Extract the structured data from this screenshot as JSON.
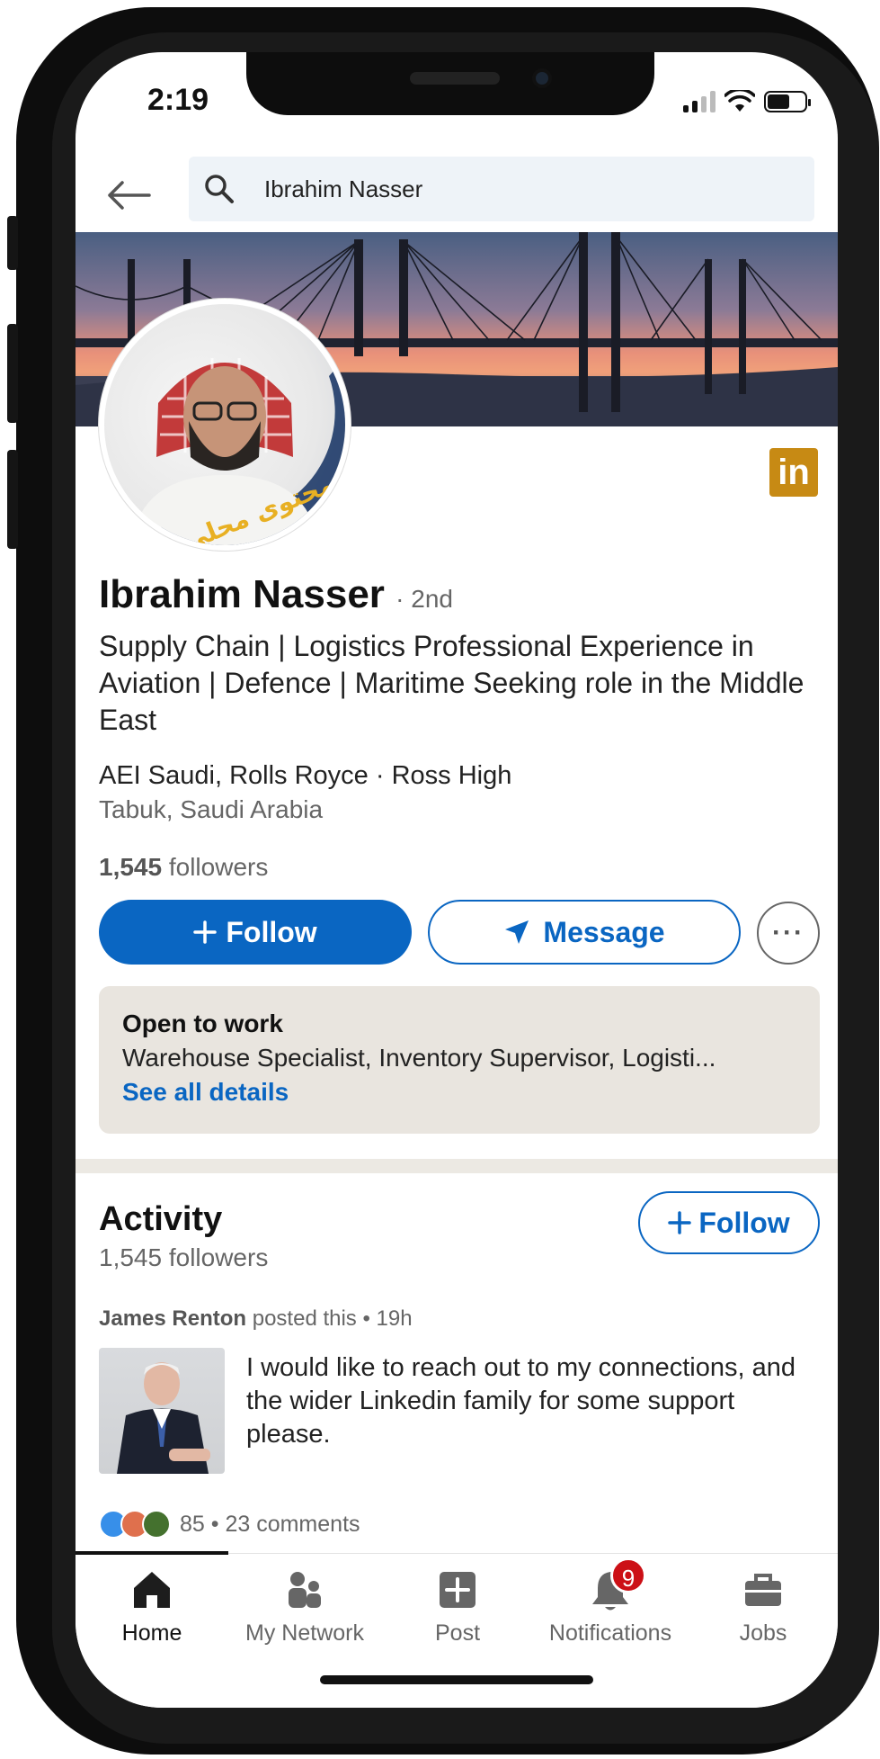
{
  "status_bar": {
    "time": "2:19"
  },
  "search": {
    "query": "Ibrahim Nasser"
  },
  "profile": {
    "name": "Ibrahim Nasser",
    "degree": "· 2nd",
    "headline": "Supply Chain | Logistics Professional Experience in Aviation | Defence | Maritime Seeking role in the Middle East",
    "company": "AEI Saudi, Rolls Royce · Ross High",
    "location": "Tabuk, Saudi Arabia",
    "followers_count": "1,545",
    "followers_label": " followers",
    "avatar_text_line1": "أنا محتوى محلي",
    "linkedin_badge": "in"
  },
  "actions": {
    "follow_label": "Follow",
    "message_label": "Message",
    "more_label": "···"
  },
  "open_to_work": {
    "title": "Open to work",
    "roles": "Warehouse Specialist, Inventory Supervisor, Logisti...",
    "link": "See all details"
  },
  "activity": {
    "title": "Activity",
    "followers": "1,545 followers",
    "follow_label": "Follow",
    "post": {
      "author": "James Renton",
      "meta": " posted this • 19h",
      "text": "I would like to reach out to my connections, and the wider Linkedin family for some support please.",
      "reactions_summary": "85 • 23 comments"
    }
  },
  "bottom_nav": {
    "items": [
      {
        "label": "Home",
        "icon": "home-icon",
        "active": true
      },
      {
        "label": "My Network",
        "icon": "network-icon",
        "active": false
      },
      {
        "label": "Post",
        "icon": "post-icon",
        "active": false
      },
      {
        "label": "Notifications",
        "icon": "bell-icon",
        "active": false,
        "badge": "9"
      },
      {
        "label": "Jobs",
        "icon": "briefcase-icon",
        "active": false
      }
    ]
  },
  "colors": {
    "brand_blue": "#0a66c2",
    "open_to_work_bg": "#e9e5df",
    "badge_red": "#cc1016",
    "linkedin_badge_gold": "#c78a14"
  }
}
